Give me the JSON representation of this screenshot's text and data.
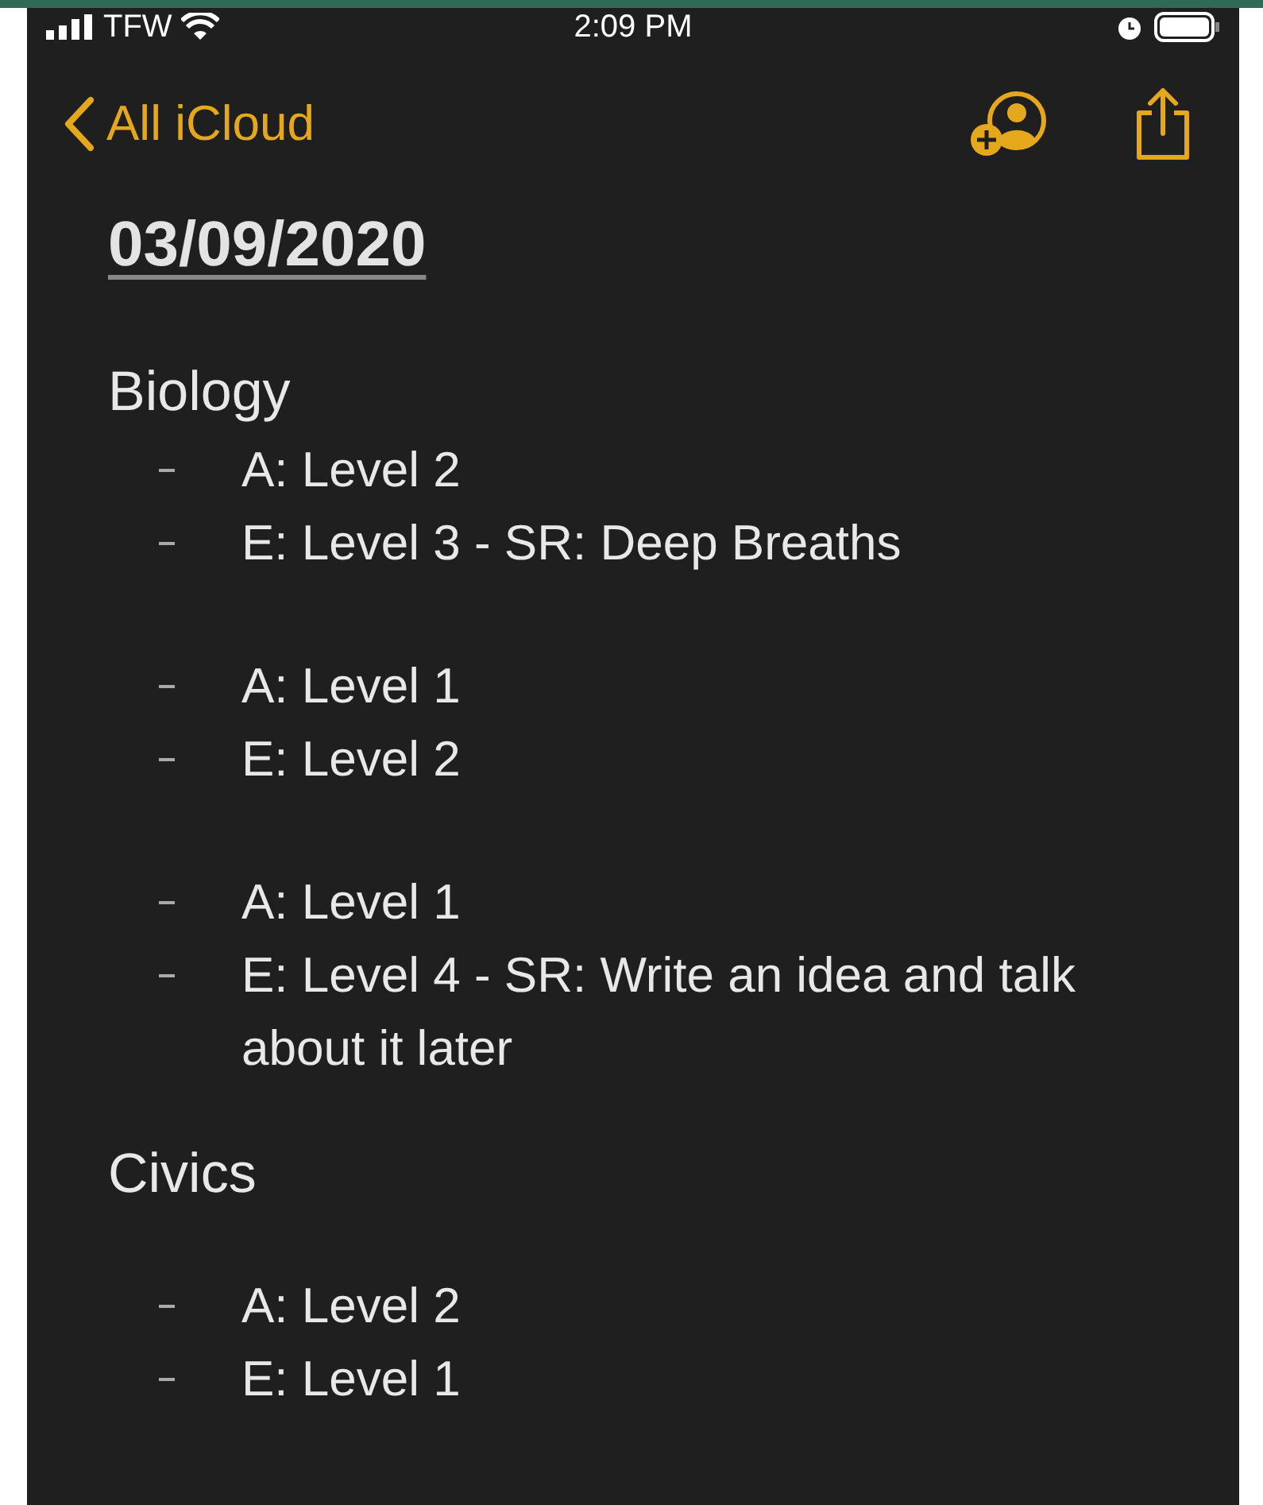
{
  "status_bar": {
    "carrier": "TFW",
    "time": "2:09 PM"
  },
  "nav": {
    "back_label": "All iCloud"
  },
  "note": {
    "title": "03/09/2020",
    "sections": [
      {
        "heading": "Biology",
        "groups": [
          [
            "A: Level 2",
            "E: Level 3 - SR: Deep Breaths"
          ],
          [
            "A: Level 1",
            "E: Level 2"
          ],
          [
            "A: Level 1",
            "E: Level 4 - SR: Write an idea and talk about it later"
          ]
        ]
      },
      {
        "heading": "Civics",
        "groups": [
          [
            "A: Level 2",
            "E: Level 1"
          ]
        ]
      }
    ]
  }
}
